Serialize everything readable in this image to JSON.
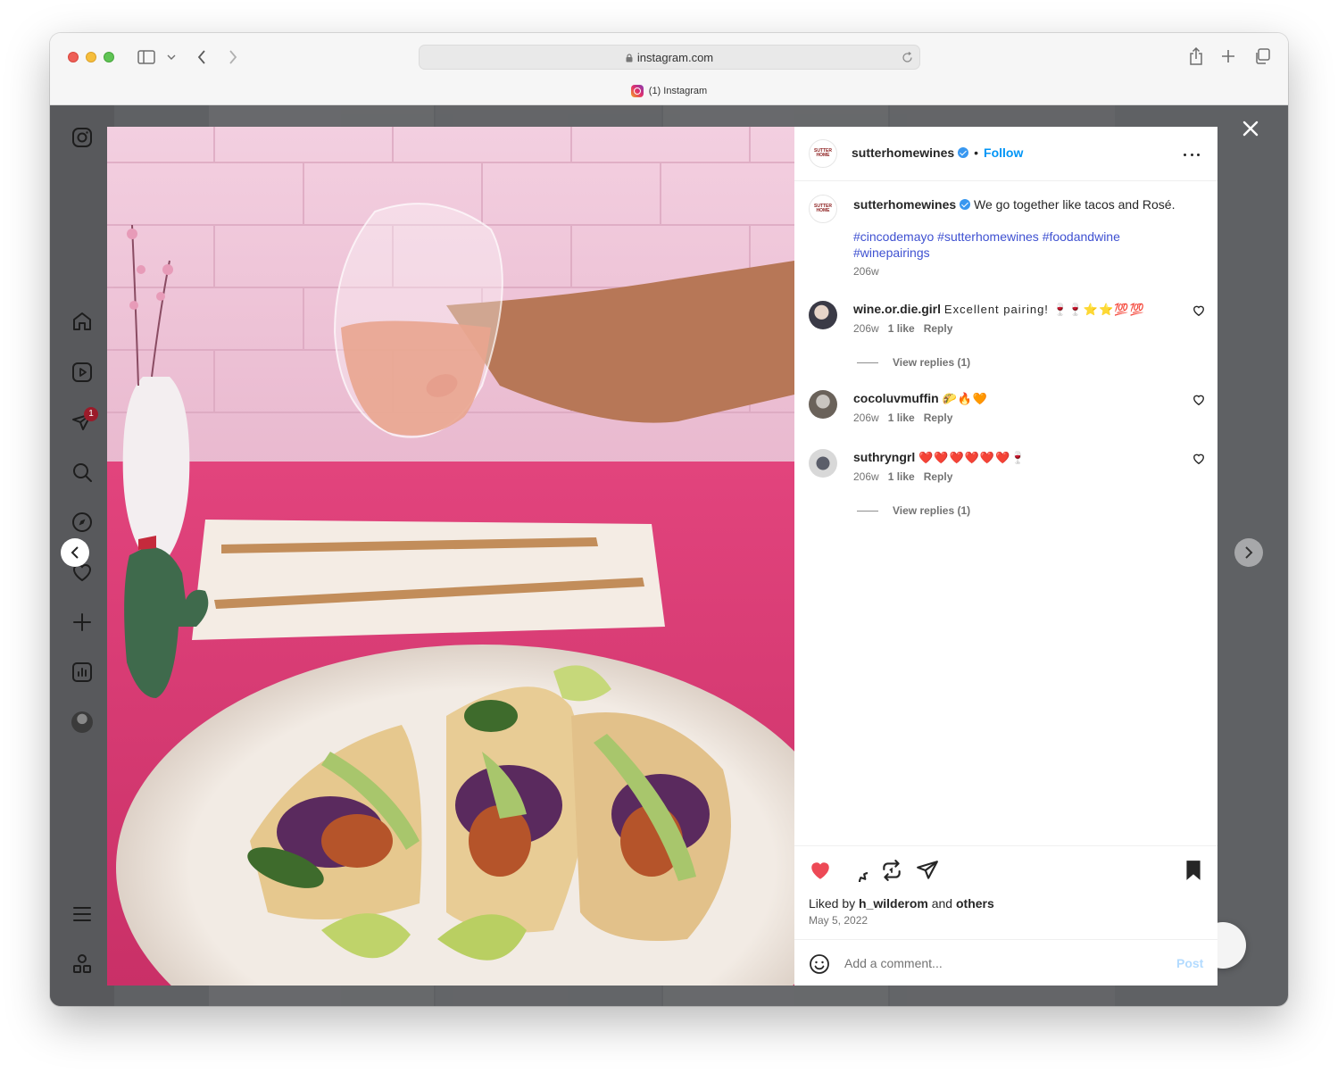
{
  "browser": {
    "url": "instagram.com",
    "tab_title": "(1) Instagram"
  },
  "sidebar": {
    "notification_count": "1",
    "icons": [
      "instagram-icon",
      "home-icon",
      "reels-icon",
      "messages-icon",
      "search-icon",
      "explore-icon",
      "notifications-icon",
      "create-icon",
      "dashboard-icon",
      "profile-avatar",
      "menu-icon",
      "apps-icon"
    ]
  },
  "post": {
    "author": "sutterhomewines",
    "follow_label": "Follow",
    "avatar_text": "SUTTER HOME",
    "caption": "We go together like tacos and Rosé.",
    "hashtags": [
      "#cincodemayo",
      "#sutterhomewines",
      "#foodandwine",
      "#winepairings"
    ],
    "caption_time": "206w",
    "liked_by_prefix": "Liked by",
    "liked_by_user": "h_wilderom",
    "liked_by_and": "and",
    "liked_by_others": "others",
    "date": "May 5, 2022"
  },
  "comments": [
    {
      "user": "wine.or.die.girl",
      "text": "Excellent pairing! 🍷🍷⭐⭐💯💯",
      "time": "206w",
      "likes": "1 like",
      "reply": "Reply",
      "view_replies": "View replies (1)"
    },
    {
      "user": "cocoluvmuffin",
      "text": "🌮🔥🧡",
      "time": "206w",
      "likes": "1 like",
      "reply": "Reply"
    },
    {
      "user": "suthryngrl",
      "text": "❤️❤️❤️❤️❤️❤️🍷",
      "time": "206w",
      "likes": "1 like",
      "reply": "Reply",
      "view_replies": "View replies (1)"
    }
  ],
  "comment_box": {
    "placeholder": "Add a comment...",
    "post_label": "Post"
  },
  "colors": {
    "like_red": "#ed4956",
    "link_blue": "#0095f6",
    "hashtag_blue": "#3f51d1",
    "overlay": "#5f6164"
  }
}
